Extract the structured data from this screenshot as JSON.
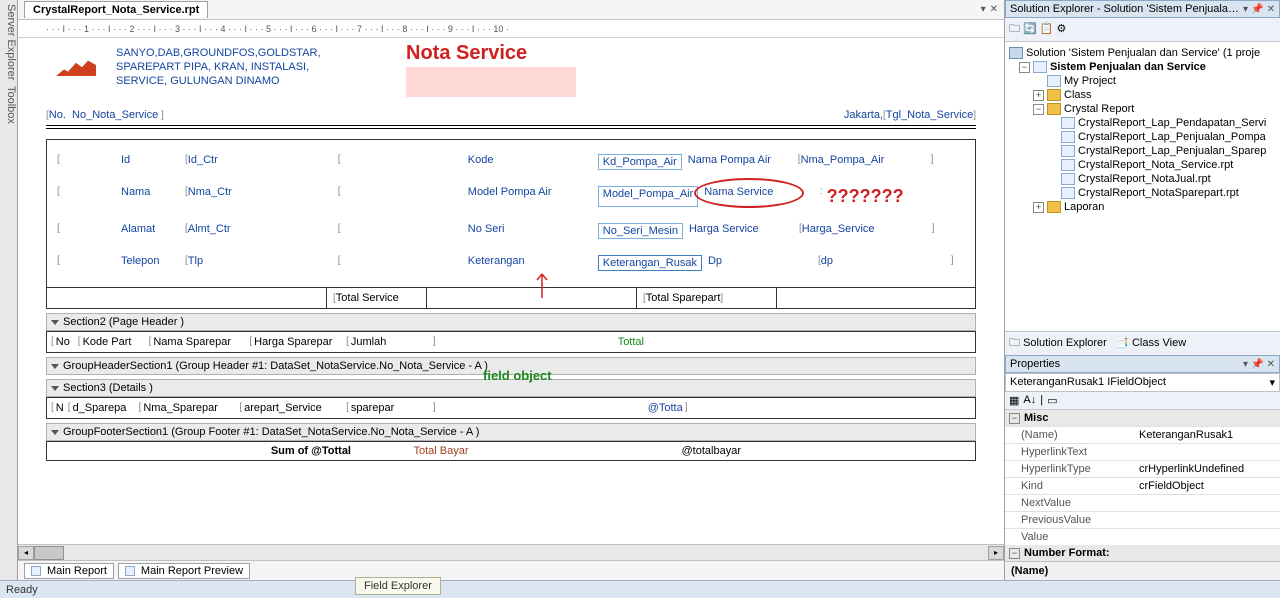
{
  "tab": {
    "title": "CrystalReport_Nota_Service.rpt"
  },
  "side_tools": [
    "Server Explorer",
    "Toolbox"
  ],
  "ruler": "· · · I · · · 1 · · · I · · · 2 · · · I · · · 3 · · · I · · · 4 · · · I · · · 5 · · · I · · · 6 · · · I · · · 7 · · · I · · · 8 · · · I · · · 9 · · · I · · · 10 ·",
  "report": {
    "company_lines": "SANYO,DAB,GROUNDFOS,GOLDSTAR,\nSPAREPART PIPA, KRAN, INSTALASI,\nSERVICE, GULUNGAN DINAMO",
    "title": "Nota Service",
    "no_label": "No.",
    "no_field": "No_Nota_Service",
    "city": "Jakarta,",
    "tgl_field": "Tgl_Nota_Service",
    "left_rows": [
      {
        "l": "Id",
        "v": "Id_Ctr"
      },
      {
        "l": "Nama",
        "v": "Nma_Ctr"
      },
      {
        "l": "Alamat",
        "v": "Almt_Ctr"
      },
      {
        "l": "Telepon",
        "v": "Tlp"
      }
    ],
    "mid_rows": [
      {
        "l": "Kode",
        "f": "Kd_Pompa_Air"
      },
      {
        "l": "Model Pompa Air",
        "f": "Model_Pompa_Air"
      },
      {
        "l": "No Seri",
        "f": "No_Seri_Mesin"
      },
      {
        "l": "Keterangan",
        "f": "Keterangan_Rusak"
      }
    ],
    "right_rows": [
      {
        "l": "Nama Pompa Air",
        "v": "Nma_Pompa_Air"
      },
      {
        "l": "Nama Service",
        "v": ""
      },
      {
        "l": "Harga Service",
        "v": "Harga_Service"
      },
      {
        "l": "Dp",
        "v": "dp"
      }
    ],
    "qmarks": "???????",
    "annot_fieldobject": "field object",
    "total_service": "Total Service",
    "total_sparepart": "Total Sparepart",
    "section2": "Section2 (Page Header )",
    "ghdr_cols": [
      "No",
      "Kode Part",
      "Nama Sparepar",
      "Harga Sparepar",
      "Jumlah"
    ],
    "tottal_green": "Tottal",
    "ghs1": "GroupHeaderSection1 (Group Header #1: DataSet_NotaService.No_Nota_Service - A )",
    "section3": "Section3 (Details )",
    "det_cols": [
      "N",
      "d_Sparepa",
      "Nma_Sparepar",
      "arepart_Service",
      "sparepar"
    ],
    "at_totta": "@Totta",
    "gfs1": "GroupFooterSection1 (Group Footer #1: DataSet_NotaService.No_Nota_Service - A )",
    "sum_totta": "Sum of @Tottal",
    "total_bayar": "Total Bayar",
    "at_totalbayar": "@totalbayar"
  },
  "bottom_tabs": {
    "main": "Main Report",
    "preview": "Main Report Preview"
  },
  "se": {
    "title": "Solution Explorer - Solution 'Sistem Penjuala…",
    "root": "Solution 'Sistem Penjualan dan Service' (1 proje",
    "proj": "Sistem Penjualan dan Service",
    "myproj": "My Project",
    "class": "Class",
    "cr": "Crystal Report",
    "files": [
      "CrystalReport_Lap_Pendapatan_Servi",
      "CrystalReport_Lap_Penjualan_Pompa",
      "CrystalReport_Lap_Penjualan_Sparep",
      "CrystalReport_Nota_Service.rpt",
      "CrystalReport_NotaJual.rpt",
      "CrystalReport_NotaSparepart.rpt"
    ],
    "laporan": "Laporan",
    "tab_se": "Solution Explorer",
    "tab_cv": "Class View"
  },
  "props": {
    "title": "Properties",
    "obj": "KeteranganRusak1 IFieldObject",
    "cat_misc": "Misc",
    "rows": [
      {
        "k": "(Name)",
        "v": "KeteranganRusak1"
      },
      {
        "k": "HyperlinkText",
        "v": ""
      },
      {
        "k": "HyperlinkType",
        "v": "crHyperlinkUndefined"
      },
      {
        "k": "Kind",
        "v": "crFieldObject"
      },
      {
        "k": "NextValue",
        "v": ""
      },
      {
        "k": "PreviousValue",
        "v": ""
      },
      {
        "k": "Value",
        "v": ""
      }
    ],
    "cat_nf": "Number Format:",
    "desc": "(Name)"
  },
  "status": {
    "ready": "Ready",
    "fe": "Field Explorer"
  }
}
